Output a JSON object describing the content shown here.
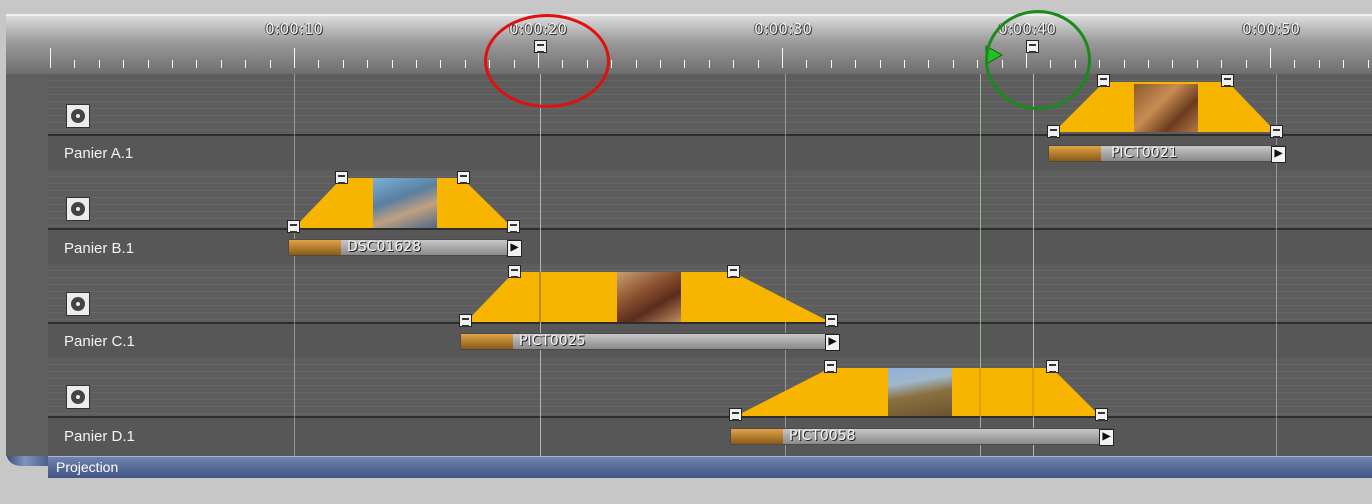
{
  "ruler": {
    "time_labels": [
      "0:00:10",
      "0:00:20",
      "0:00:30",
      "0:00:40",
      "0:00:50"
    ]
  },
  "tracks": [
    {
      "letter": "A",
      "label": "Panier A.1"
    },
    {
      "letter": "B",
      "label": "Panier B.1"
    },
    {
      "letter": "C",
      "label": "Panier C.1"
    },
    {
      "letter": "D",
      "label": "Panier D.1"
    }
  ],
  "clips": [
    {
      "track": "A",
      "name": "PICT0021"
    },
    {
      "track": "B",
      "name": "DSC01628"
    },
    {
      "track": "C",
      "name": "PICT0025"
    },
    {
      "track": "D",
      "name": "PICT0058"
    }
  ],
  "bottom_bar": {
    "label": "Projection"
  },
  "colors": {
    "clip_fill": "#f7b500",
    "annotation_red": "#e01010",
    "annotation_green": "#1a8a1a",
    "playhead_green": "#22c022",
    "sidebar_blue": "#5a6f9f"
  },
  "icons": {
    "track_audio": "speaker-icon",
    "keyframe": "keyframe-handle-icon",
    "clip_end": "clip-end-arrow-icon",
    "playhead": "playhead-marker-icon"
  }
}
